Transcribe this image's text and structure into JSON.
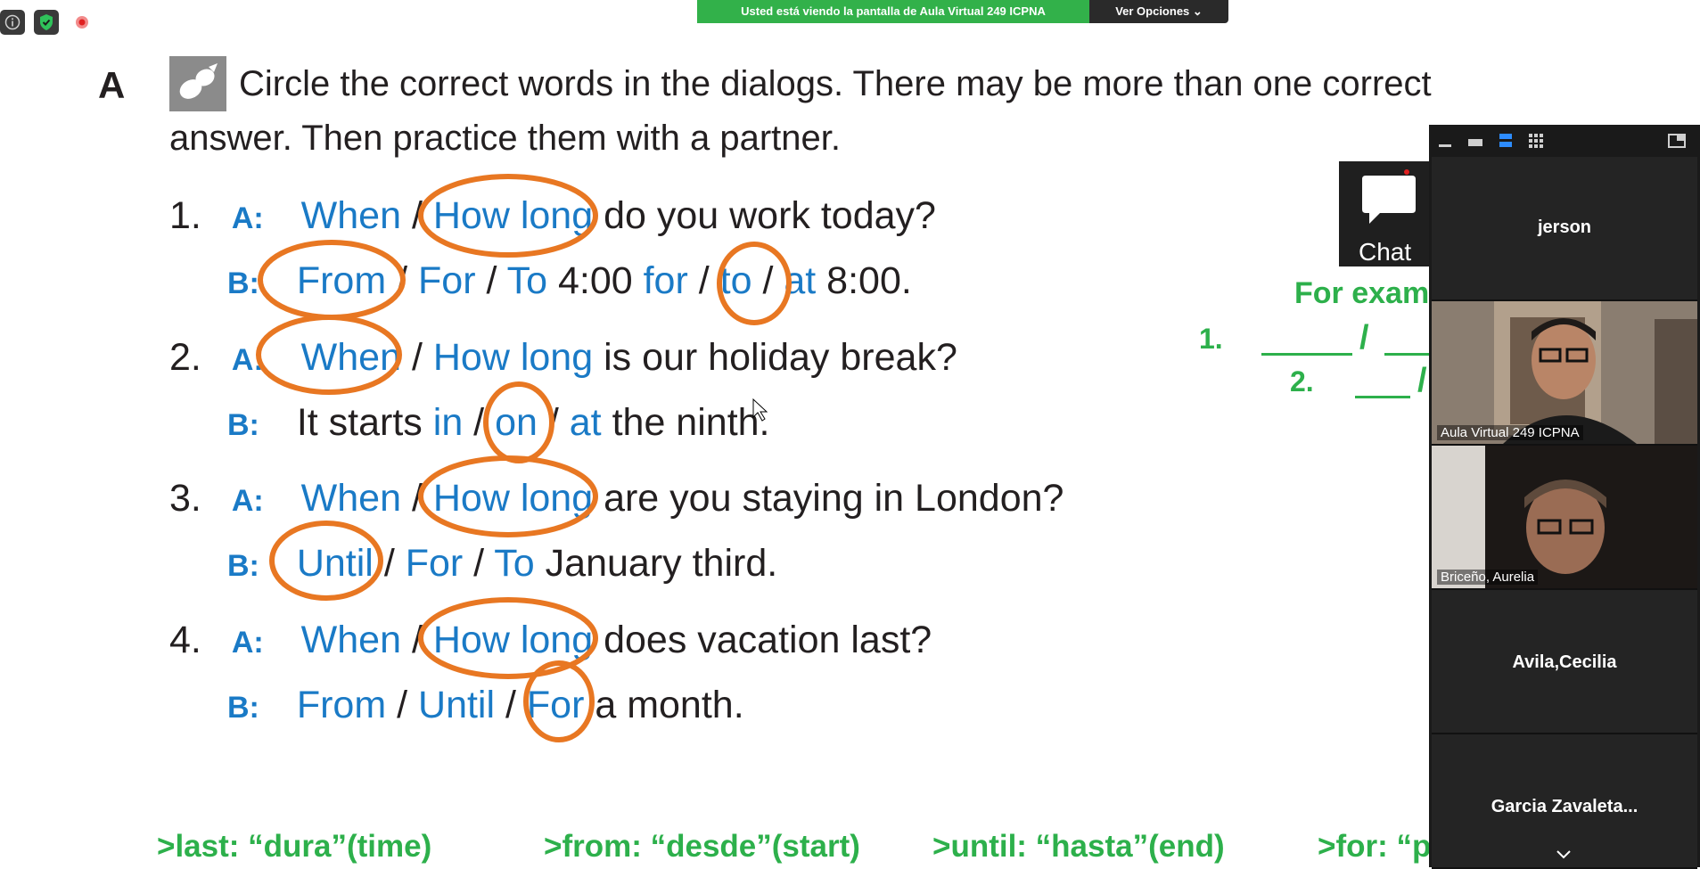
{
  "meeting": {
    "share_banner": "Usted está viendo la pantalla de Aula Virtual 249 ICPNA",
    "view_options": "Ver Opciones",
    "chat_label": "Chat"
  },
  "exercise": {
    "letter": "A",
    "instruction_1": "Circle the correct words in the dialogs. There may be more than one correct",
    "instruction_2": "answer. Then practice them with a partner.",
    "items": [
      {
        "num": "1.",
        "a_prefix": "When",
        "a_sep": " / ",
        "a_choice2": "How long",
        "a_rest": " do you work today?",
        "b_parts": [
          "From",
          " / ",
          "For",
          " / ",
          "To",
          " 4:00 ",
          "for",
          " / ",
          "to",
          " / ",
          "at",
          " 8:00."
        ]
      },
      {
        "num": "2.",
        "a_prefix": "When",
        "a_sep": " / ",
        "a_choice2": "How long",
        "a_rest": " is our holiday break?",
        "b_parts": [
          "It starts ",
          "in",
          " / ",
          "on",
          " / ",
          "at",
          " the ninth."
        ]
      },
      {
        "num": "3.",
        "a_prefix": "When",
        "a_sep": " / ",
        "a_choice2": "How long",
        "a_rest": " are you staying in London?",
        "b_parts": [
          "Until",
          " / ",
          "For",
          " / ",
          "To",
          " January third."
        ]
      },
      {
        "num": "4.",
        "a_prefix": "When",
        "a_sep": " / ",
        "a_choice2": "How long",
        "a_rest": " does vacation last?",
        "b_parts": [
          "From",
          " / ",
          "Until",
          " / ",
          "For",
          " a month."
        ]
      }
    ],
    "speaker_a": "A:",
    "speaker_b": "B:"
  },
  "annotations": {
    "for_example": "For exam",
    "ex1": "1.",
    "ex2": "2.",
    "slash": "/",
    "gloss": [
      ">last: “dura”(time)",
      ">from: “desde”(start)",
      ">until: “hasta”(end)",
      ">for: “p"
    ]
  },
  "participants": [
    {
      "name": "jerson",
      "video": false
    },
    {
      "name": "Aula Virtual 249 ICPNA",
      "video": true
    },
    {
      "name": "Briceño, Aurelia",
      "video": true
    },
    {
      "name": "Avila,Cecilia",
      "video": false
    },
    {
      "name": "Garcia  Zavaleta...",
      "video": false
    }
  ],
  "colors": {
    "accent_blue": "#1a7ac6",
    "circle_orange": "#e87722",
    "annotation_green": "#2db04b",
    "banner_green": "#32b14a"
  }
}
